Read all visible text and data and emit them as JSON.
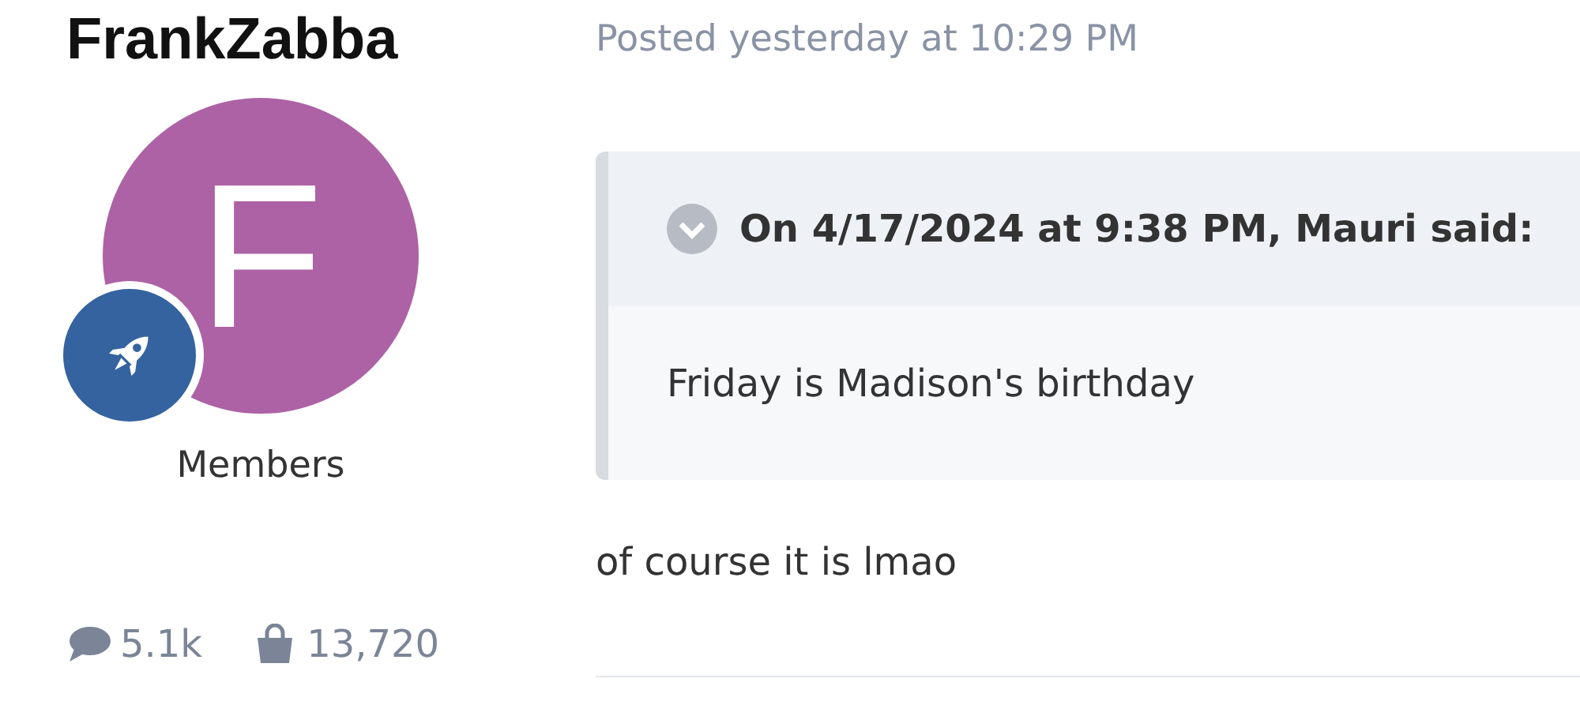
{
  "author": {
    "name": "FrankZabba",
    "avatar_letter": "F",
    "group": "Members",
    "posts": "5.1k",
    "points": "13,720"
  },
  "post": {
    "posted": "Posted yesterday at 10:29 PM",
    "quote": {
      "citation": "On 4/17/2024 at 9:38 PM, Mauri said:",
      "text": "Friday is Madison's birthday"
    },
    "body": "of course it is lmao"
  }
}
